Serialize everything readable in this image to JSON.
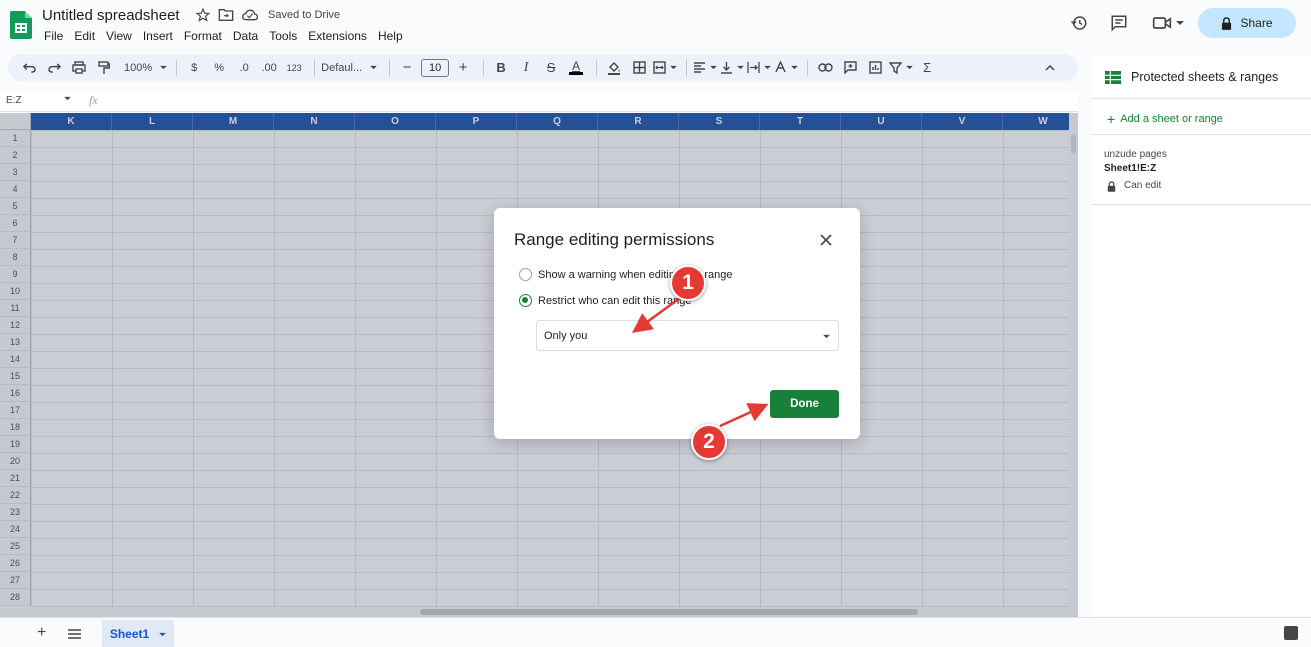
{
  "header": {
    "title": "Untitled spreadsheet",
    "saved_status": "Saved to Drive",
    "share_label": "Share"
  },
  "menu": [
    "File",
    "Edit",
    "View",
    "Insert",
    "Format",
    "Data",
    "Tools",
    "Extensions",
    "Help"
  ],
  "toolbar": {
    "zoom": "100%",
    "currency": "$",
    "percent": "%",
    "decrease_decimal": ".0",
    "increase_decimal": ".00",
    "number_format": "123",
    "font": "Defaul...",
    "font_size": "10",
    "bold": "B",
    "italic": "I",
    "text_color": "A",
    "sum": "Σ"
  },
  "formula_bar": {
    "name_box": "E:Z",
    "fx": "fx"
  },
  "grid": {
    "columns": [
      "K",
      "L",
      "M",
      "N",
      "O",
      "P",
      "Q",
      "R",
      "S",
      "T",
      "U",
      "V",
      "W"
    ],
    "rows": [
      "1",
      "2",
      "3",
      "4",
      "5",
      "6",
      "7",
      "8",
      "9",
      "10",
      "11",
      "12",
      "13",
      "14",
      "15",
      "16",
      "17",
      "18",
      "19",
      "20",
      "21",
      "22",
      "23",
      "24",
      "25",
      "26",
      "27",
      "28"
    ]
  },
  "sheet_tabs": {
    "active": "Sheet1"
  },
  "side_panel": {
    "title": "Protected sheets & ranges",
    "add_label": "Add a sheet or range",
    "range": {
      "description": "unzude pages",
      "reference": "Sheet1!E:Z",
      "permission": "Can edit"
    }
  },
  "dialog": {
    "title": "Range editing permissions",
    "option_warning": "Show a warning when editing this range",
    "option_restrict": "Restrict who can edit this range",
    "selected_option": "restrict",
    "editor_select": "Only you",
    "done_label": "Done"
  },
  "annotations": {
    "badge_1": "1",
    "badge_2": "2",
    "color": "#e53935"
  },
  "colors": {
    "accent_green": "#188038",
    "column_header": "#0b47a6",
    "share_bg": "#c2e7ff"
  }
}
